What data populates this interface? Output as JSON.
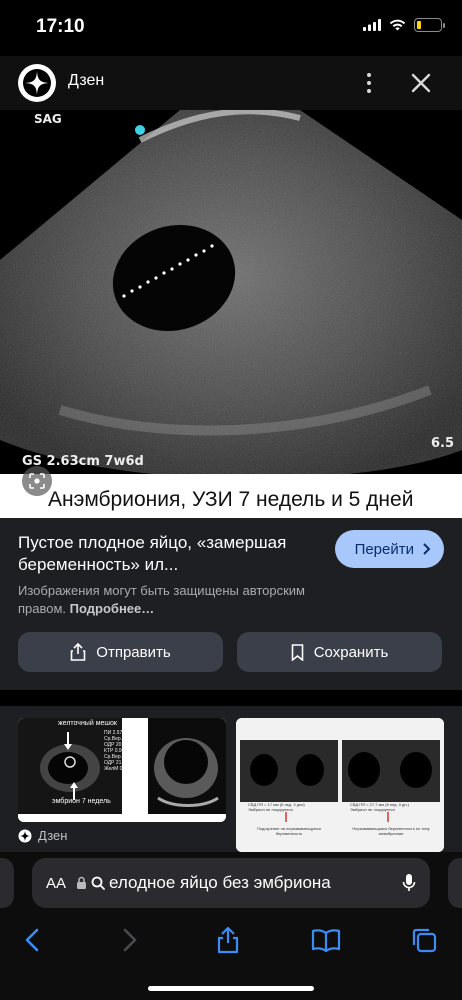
{
  "status": {
    "time": "17:10",
    "battery_level": 0.18,
    "battery_color": "#ffd60a"
  },
  "header": {
    "source_name": "Дзен",
    "more_icon": "more-vertical-icon",
    "close_icon": "close-icon"
  },
  "hero": {
    "ultrasound_label_sag": "SAG",
    "measurement": "GS 2.63cm 7w6d",
    "depth": "6.5",
    "caption": "Анэмбриония, УЗИ 7 недель и 5 дней"
  },
  "info": {
    "title": "Пустое плодное яйцо, «замершая беременность» ил...",
    "visit_label": "Перейти",
    "copyright_text": "Изображения могут быть защищены авторским правом.",
    "copyright_more": "Подробнее…",
    "share_label": "Отправить",
    "save_label": "Сохранить",
    "accent_color": "#a8c7fa"
  },
  "related": {
    "thumb1_labels": [
      "желточный мешок",
      "эмбрион 7 недель",
      "ПИ 2.57",
      "Ср.Вер.",
      "ОДР 20.",
      "КТР 0.99",
      "Ср.Вер.",
      "ОДР 21.",
      "ЖелМ 0."
    ],
    "thumb2_captions": [
      "СВД ПЯ = 17 мм (6 нед. 3 дня)",
      "Эмбрион не лоцируется",
      "СВД ПЯ = 27,7 мм (8 нед. 0 дн.)",
      "Эмбрион не лоцируется",
      "Подозрение на неразвивающуюся беременность",
      "Неразвивающаяся беременность по типу анэмбрионии"
    ],
    "source_name": "Дзен"
  },
  "browser": {
    "aa_label": "AA",
    "url_text": "елодное яйцо без эмбриона",
    "toolbar_icons": [
      "back-icon",
      "forward-icon",
      "share-icon",
      "bookmarks-icon",
      "tabs-icon"
    ]
  }
}
